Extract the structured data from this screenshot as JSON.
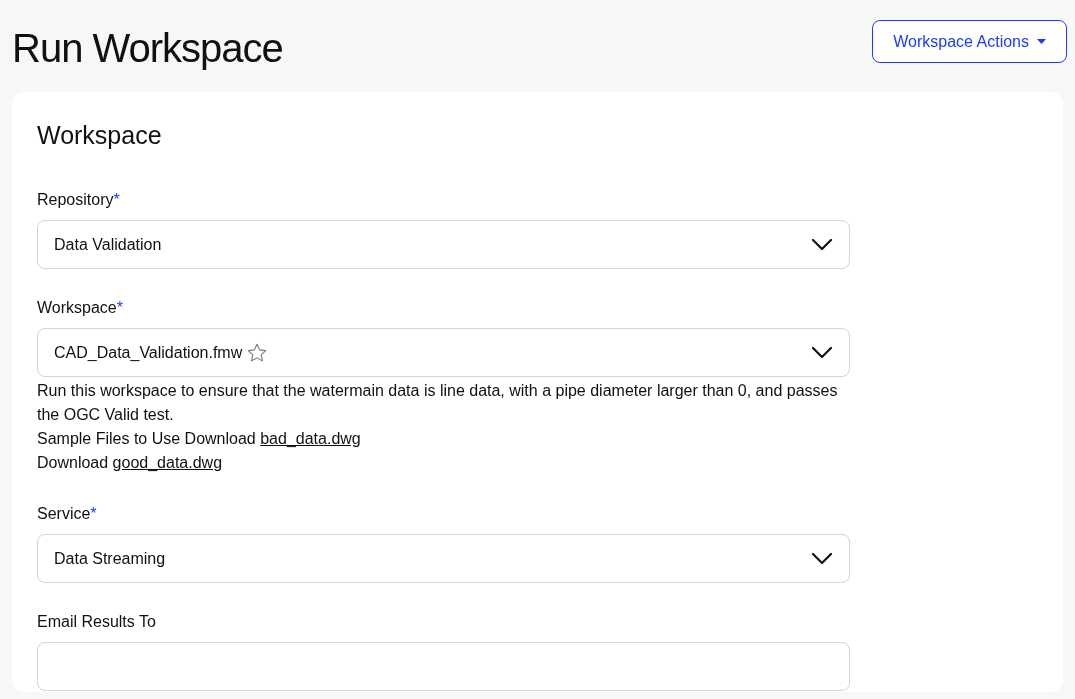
{
  "title": "Run Workspace",
  "actions_button": {
    "label": "Workspace Actions"
  },
  "card": {
    "heading": "Workspace",
    "fields": [
      {
        "kind": "select",
        "label": "Repository",
        "required_mark": "*",
        "value": "Data Validation"
      },
      {
        "kind": "select",
        "label": "Workspace",
        "required_mark": "*",
        "value": "CAD_Data_Validation.fmw",
        "favorite": false,
        "description": "Run this workspace to ensure that the watermain data is line data, with a pipe diameter larger than 0, and passes the OGC Valid test.",
        "downloads": [
          {
            "text": "Sample Files to Use Download",
            "link": "bad_data.dwg"
          },
          {
            "text": "Download",
            "link": "good_data.dwg"
          }
        ]
      },
      {
        "kind": "select",
        "label": "Service",
        "required_mark": "*",
        "value": "Data Streaming"
      },
      {
        "kind": "text",
        "label": "Email Results To"
      }
    ]
  }
}
